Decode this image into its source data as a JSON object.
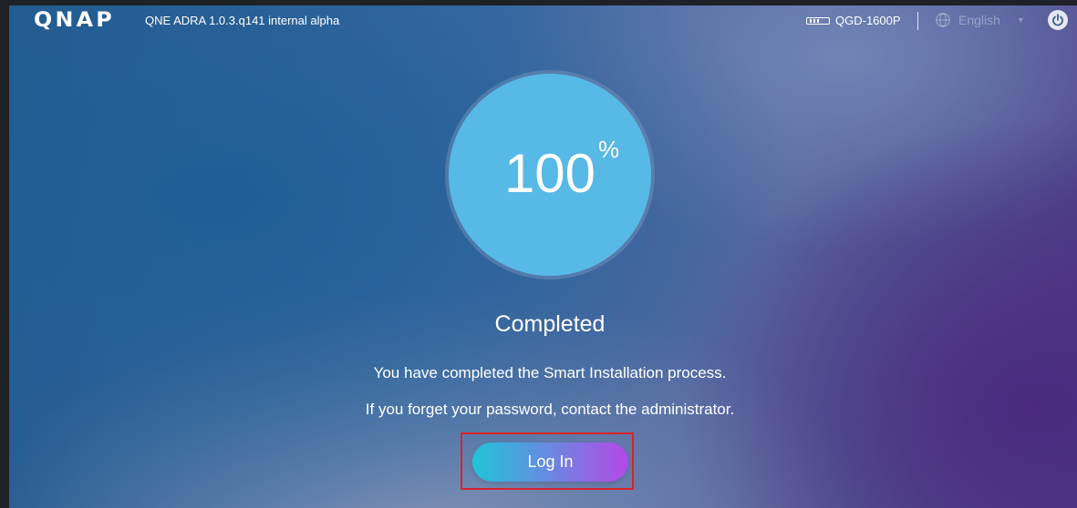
{
  "header": {
    "logo_text": "QNAP",
    "app_version": "QNE ADRA 1.0.3.q141 internal alpha",
    "device_model": "QGD-1600P",
    "language": "English"
  },
  "progress": {
    "value": "100",
    "unit": "%"
  },
  "status": {
    "title": "Completed",
    "message_1": "You have completed the Smart Installation process.",
    "message_2": "If you forget your password, contact the administrator."
  },
  "actions": {
    "login_label": "Log In"
  },
  "colors": {
    "progress_fill": "#57b9e6",
    "button_gradient_start": "#20c4d8",
    "button_gradient_end": "#b548e8",
    "highlight_border": "#d8232a"
  },
  "icons": {
    "device": "nas-device-icon",
    "language": "globe-icon",
    "dropdown": "chevron-down-icon",
    "power": "power-icon"
  }
}
